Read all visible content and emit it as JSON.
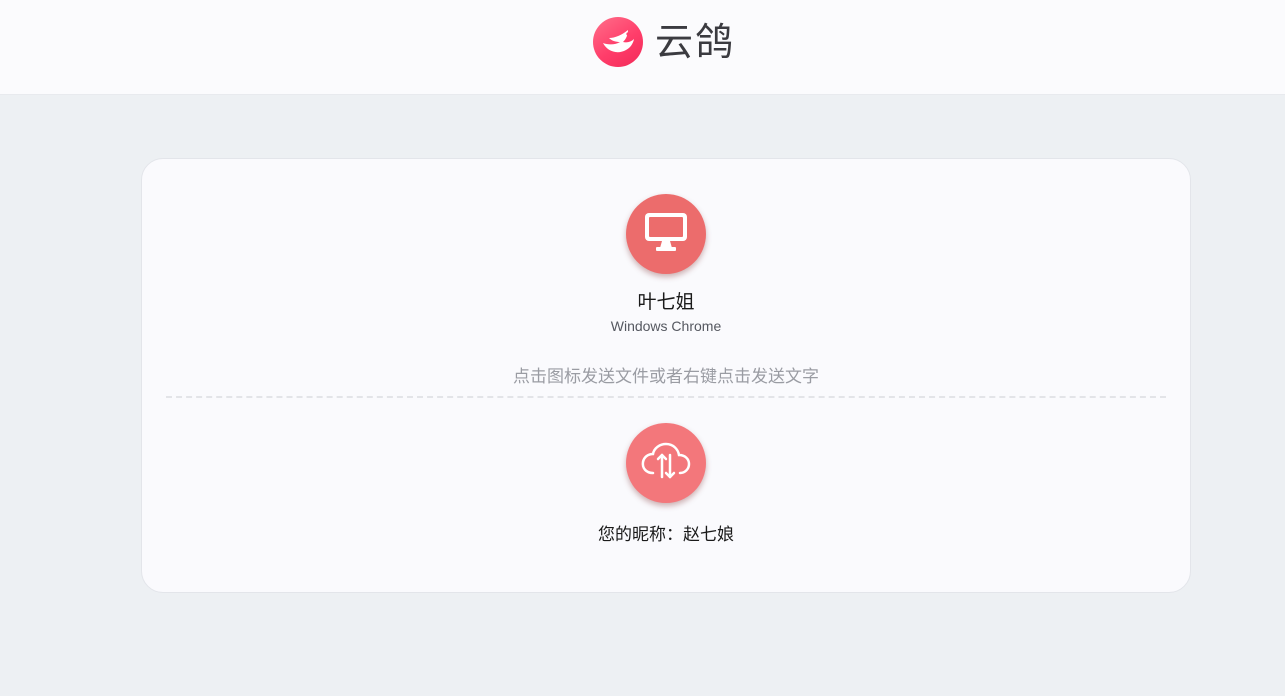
{
  "header": {
    "app_name": "云鸽",
    "logo_icon": "dove-icon",
    "logo_color": "#ff3d6a"
  },
  "peer": {
    "name": "叶七姐",
    "device": "Windows Chrome",
    "icon": "desktop-monitor-icon",
    "avatar_color": "#ec6c6c"
  },
  "hint": "点击图标发送文件或者右键点击发送文字",
  "self": {
    "icon": "cloud-transfer-icon",
    "avatar_color": "#f3777b",
    "nickname_label": "您的昵称：",
    "nickname": "赵七娘"
  }
}
